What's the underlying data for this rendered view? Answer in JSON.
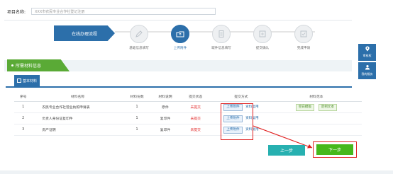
{
  "project": {
    "label": "项目名称:",
    "value": "XXX市农民专业合作社登记注册"
  },
  "process": {
    "title": "在线办理流程",
    "steps": [
      {
        "label": "基础信息填写",
        "active": false,
        "icon": "edit-icon"
      },
      {
        "label": "上传附件",
        "active": true,
        "icon": "upload-folder-icon"
      },
      {
        "label": "取件信息填写",
        "active": false,
        "icon": "document-icon"
      },
      {
        "label": "提交确认",
        "active": false,
        "icon": "submit-icon"
      },
      {
        "label": "完成申请",
        "active": false,
        "icon": "check-icon"
      }
    ]
  },
  "section": {
    "title": "所需材料信息",
    "subtab": "基本材料"
  },
  "table": {
    "headers": [
      "序号",
      "材料名称",
      "材料份数",
      "材料说明",
      "提交状态",
      "提交方式",
      "材料范本"
    ],
    "rows": [
      {
        "no": "1",
        "name": "农民专业合作社营业执照申请表",
        "count": "1",
        "desc": "原件",
        "status": "未提交",
        "upload": "上传附件",
        "reuse": "资料复用",
        "sample1": "空白模板",
        "sample2": "范例文本"
      },
      {
        "no": "2",
        "name": "负责人身份证复印件",
        "count": "1",
        "desc": "复印件",
        "status": "未提交",
        "upload": "上传附件",
        "reuse": "资料复用",
        "sample1": "",
        "sample2": ""
      },
      {
        "no": "3",
        "name": "房产证明",
        "count": "1",
        "desc": "复印件",
        "status": "未提交",
        "upload": "上传附件",
        "reuse": "资料复用",
        "sample1": "",
        "sample2": ""
      }
    ]
  },
  "buttons": {
    "prev": "上一步",
    "next": "下一步"
  },
  "sidebar": {
    "guide": "审核权",
    "service": "我的服务"
  },
  "colors": {
    "primary": "#2c6faa",
    "green": "#47b81c",
    "teal": "#27b0b0",
    "required": "#e02020",
    "highlight": "#e02020"
  }
}
